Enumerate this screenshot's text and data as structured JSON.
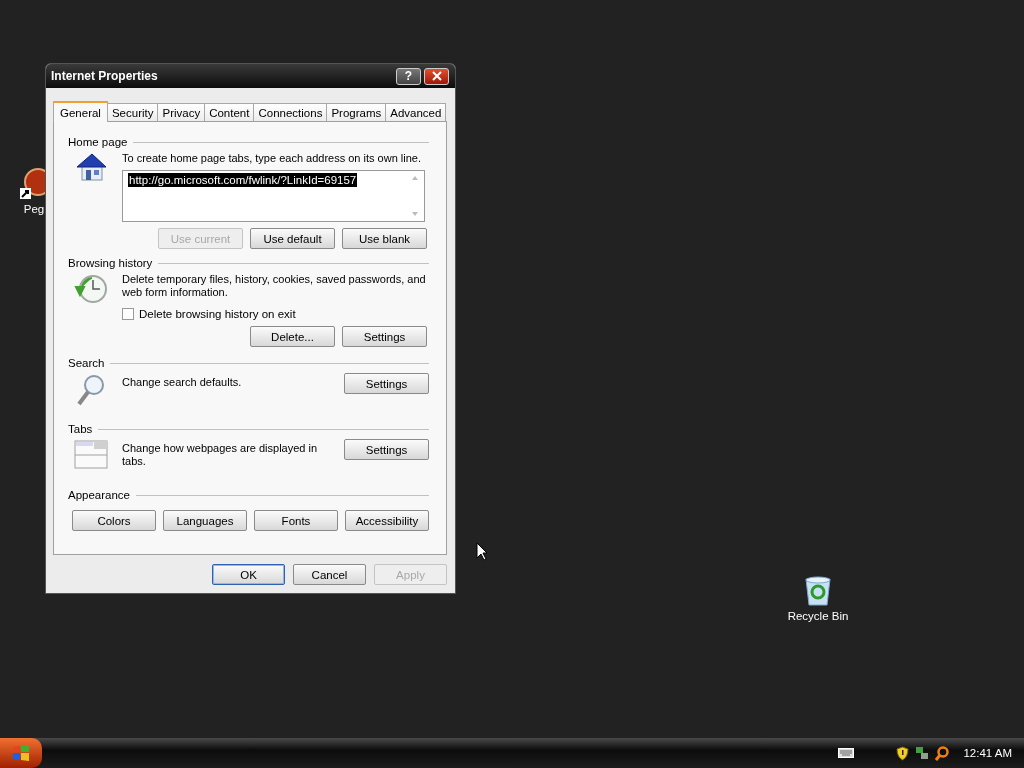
{
  "window": {
    "title": "Internet Properties",
    "help_button": "?"
  },
  "tabs": [
    {
      "label": "General",
      "selected": true
    },
    {
      "label": "Security",
      "selected": false
    },
    {
      "label": "Privacy",
      "selected": false
    },
    {
      "label": "Content",
      "selected": false
    },
    {
      "label": "Connections",
      "selected": false
    },
    {
      "label": "Programs",
      "selected": false
    },
    {
      "label": "Advanced",
      "selected": false
    }
  ],
  "home_page": {
    "heading": "Home page",
    "description": "To create home page tabs, type each address on its own line.",
    "address": {
      "value": "http://go.microsoft.com/fwlink/?LinkId=69157",
      "highlighted": true
    },
    "buttons": [
      {
        "label": "Use current",
        "disabled": true
      },
      {
        "label": "Use default",
        "disabled": false
      },
      {
        "label": "Use blank",
        "disabled": false
      }
    ]
  },
  "browsing_history": {
    "heading": "Browsing history",
    "description": "Delete temporary files, history, cookies, saved passwords, and web form information.",
    "checkbox": {
      "label": "Delete browsing history on exit",
      "checked": false
    },
    "buttons": [
      {
        "label": "Delete...",
        "disabled": false
      },
      {
        "label": "Settings",
        "disabled": false
      }
    ]
  },
  "search": {
    "heading": "Search",
    "description": "Change search defaults.",
    "buttons": [
      {
        "label": "Settings",
        "disabled": false
      }
    ]
  },
  "tabs_section": {
    "heading": "Tabs",
    "description": "Change how webpages are displayed in tabs.",
    "buttons": [
      {
        "label": "Settings",
        "disabled": false
      }
    ]
  },
  "appearance": {
    "heading": "Appearance",
    "buttons": [
      {
        "label": "Colors",
        "disabled": false
      },
      {
        "label": "Languages",
        "disabled": false
      },
      {
        "label": "Fonts",
        "disabled": false
      },
      {
        "label": "Accessibility",
        "disabled": false
      }
    ]
  },
  "dialog_buttons": [
    {
      "label": "OK",
      "disabled": false,
      "default": true
    },
    {
      "label": "Cancel",
      "disabled": false,
      "default": false
    },
    {
      "label": "Apply",
      "disabled": true,
      "default": false
    }
  ],
  "desktop_icons": [
    {
      "label": "Peg"
    },
    {
      "label": "Recycle Bin"
    }
  ],
  "taskbar": {
    "clock": "12:41 AM"
  }
}
